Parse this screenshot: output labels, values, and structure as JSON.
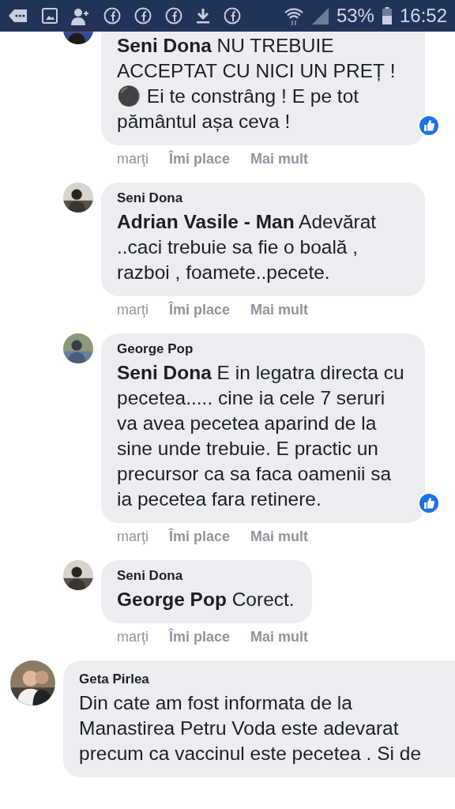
{
  "status_bar": {
    "battery": "53%",
    "time": "16:52"
  },
  "comments": [
    {
      "kind": "reply",
      "text": "**Seni Dona** NU TREBUIE ACCEPTAT CU NICI UN PREȚ ! ⚫ Ei te constrâng ! E pe tot pământul așa ceva !",
      "liked": true,
      "time": "marţi",
      "like": "Îmi place",
      "more": "Mai mult"
    },
    {
      "kind": "reply",
      "author": "Seni Dona",
      "text": "**Adrian Vasile - Man** Adevărat ..caci trebuie sa fie o boală , razboi , foamete..pecete.",
      "liked": false,
      "time": "marţi",
      "like": "Îmi place",
      "more": "Mai mult"
    },
    {
      "kind": "reply",
      "author": "George Pop",
      "text": "**Seni Dona** E in legatra directa cu pecetea..... cine ia cele 7 seruri va avea pecetea aparind de la sine unde trebuie. E practic un precursor ca sa faca oamenii sa ia pecetea fara retinere.",
      "liked": true,
      "time": "marţi",
      "like": "Îmi place",
      "more": "Mai mult"
    },
    {
      "kind": "reply",
      "author": "Seni Dona",
      "text": "**George Pop** Corect.",
      "liked": false,
      "time": "marţi",
      "like": "Îmi place",
      "more": "Mai mult"
    },
    {
      "kind": "top",
      "author": "Geta Pirlea",
      "text": "Din cate am fost informata de la Manastirea Petru Voda este adevarat precum ca vaccinul este pecetea . Si de",
      "liked": false
    }
  ]
}
